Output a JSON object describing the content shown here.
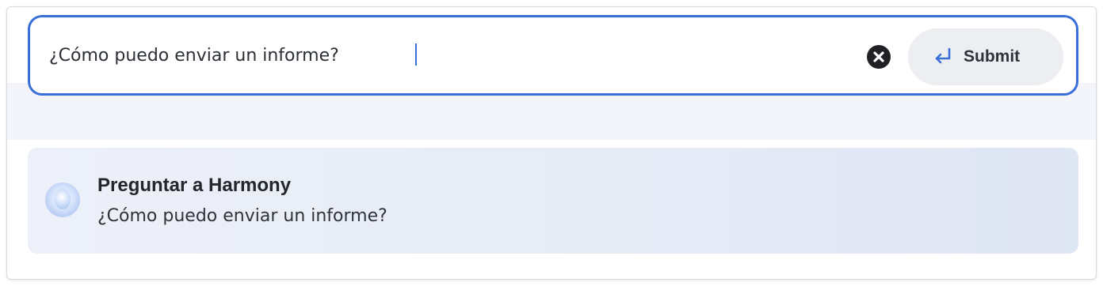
{
  "search": {
    "value": "¿Cómo puedo enviar un informe?",
    "clear_icon": "close-circle-icon",
    "submit_label": "Submit",
    "submit_icon": "return-arrow-icon"
  },
  "suggestion": {
    "title": "Preguntar a Harmony",
    "text": "¿Cómo puedo enviar un informe?",
    "icon": "harmony-orb-icon"
  },
  "colors": {
    "focus_border": "#3a6fd8",
    "submit_bg": "#eceef2",
    "suggestion_bg": "#e6ebf6"
  }
}
